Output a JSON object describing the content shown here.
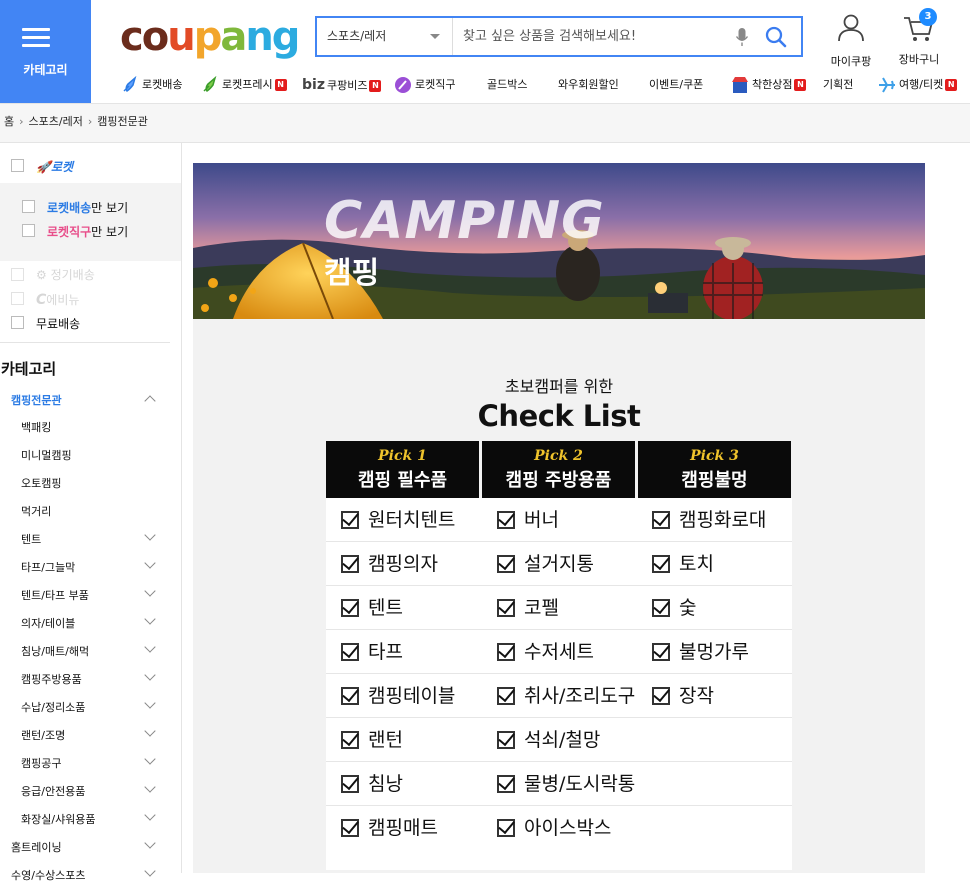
{
  "header": {
    "category_label": "카테고리",
    "logo": {
      "c1": "co",
      "c2": "u",
      "c3": "p",
      "c4": "a",
      "c5": "ng"
    },
    "search": {
      "category": "스포츠/레저",
      "placeholder": "찾고 싶은 상품을 검색해보세요!"
    },
    "my_coupang": "마이쿠팡",
    "cart": {
      "label": "장바구니",
      "count": "3"
    }
  },
  "nav": [
    {
      "label": "로켓배송",
      "icon": "rocket-icon",
      "badge": ""
    },
    {
      "label": "로켓프레시",
      "icon": "rocket-fresh-icon",
      "badge": "N"
    },
    {
      "label": "쿠팡비즈",
      "icon": "biz-icon",
      "badge": "N"
    },
    {
      "label": "로켓직구",
      "icon": "global-icon",
      "badge": ""
    },
    {
      "label": "골드박스",
      "icon": "",
      "badge": ""
    },
    {
      "label": "와우회원할인",
      "icon": "",
      "badge": ""
    },
    {
      "label": "이벤트/쿠폰",
      "icon": "",
      "badge": ""
    },
    {
      "label": "착한상점",
      "icon": "store-icon",
      "badge": "N"
    },
    {
      "label": "기획전",
      "icon": "",
      "badge": ""
    },
    {
      "label": "여행/티켓",
      "icon": "plane-icon",
      "badge": "N"
    }
  ],
  "breadcrumb": [
    "홈",
    "스포츠/레저",
    "캠핑전문관"
  ],
  "filters": {
    "rocket": "로켓",
    "rocket_only": {
      "a": "로켓배송",
      "b": "만 보기"
    },
    "rocket_global": {
      "a": "로켓직구",
      "b": "만 보기"
    },
    "subscription": "정기배송",
    "eco": "에비뉴",
    "free_shipping": "무료배송"
  },
  "sidebar": {
    "title": "카테고리",
    "current": "캠핑전문관",
    "items": [
      "백패킹",
      "미니멀캠핑",
      "오토캠핑",
      "먹거리",
      "텐트",
      "타프/그늘막",
      "텐트/타프 부품",
      "의자/테이블",
      "침낭/매트/해먹",
      "캠핑주방용품",
      "수납/정리소품",
      "랜턴/조명",
      "캠핑공구",
      "응급/안전용품",
      "화장실/샤워용품"
    ],
    "next": "홈트레이닝",
    "next2": "수영/수상스포츠"
  },
  "banner": {
    "en": "CAMPING",
    "ko": "캠핑"
  },
  "checklist": {
    "subtitle": "초보캠퍼를 위한",
    "title": "Check List",
    "picks": [
      {
        "pick": "Pick 1",
        "title": "캠핑 필수품"
      },
      {
        "pick": "Pick 2",
        "title": "캠핑 주방용품"
      },
      {
        "pick": "Pick 3",
        "title": "캠핑불멍"
      }
    ],
    "col1": [
      "원터치텐트",
      "캠핑의자",
      "텐트",
      "타프",
      "캠핑테이블",
      "랜턴",
      "침낭",
      "캠핑매트"
    ],
    "col2": [
      "버너",
      "설거지통",
      "코펠",
      "수저세트",
      "취사/조리도구",
      "석쇠/철망",
      "물병/도시락통",
      "아이스박스"
    ],
    "col3": [
      "캠핑화로대",
      "토치",
      "숯",
      "불멍가루",
      "장작"
    ]
  }
}
